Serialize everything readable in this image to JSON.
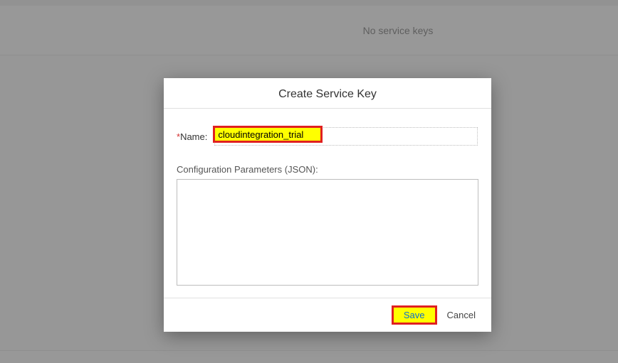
{
  "background": {
    "empty_text": "No service keys"
  },
  "dialog": {
    "title": "Create Service Key",
    "name_label": "Name:",
    "required_mark": "*",
    "name_value": "cloudintegration_trial",
    "config_label": "Configuration Parameters (JSON):",
    "config_value": "",
    "save_label": "Save",
    "cancel_label": "Cancel"
  }
}
